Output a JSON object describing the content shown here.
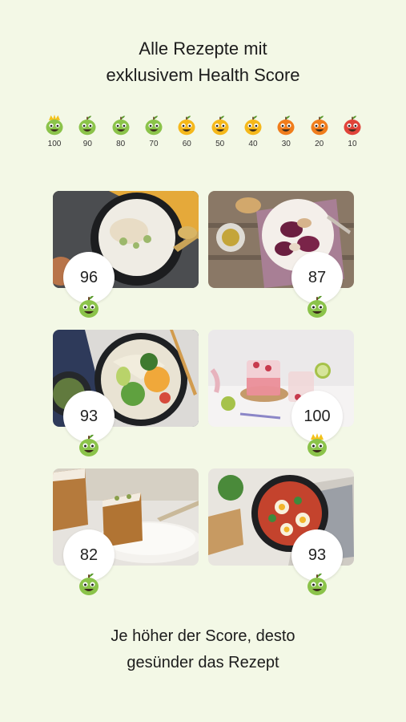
{
  "header": {
    "line1": "Alle Rezepte mit",
    "line2": "exklusivem Health Score"
  },
  "scale": [
    {
      "label": "100",
      "icon": "crown-green-mascot-icon",
      "color": "#8bc34a"
    },
    {
      "label": "90",
      "icon": "green-mascot-icon",
      "color": "#8bc34a"
    },
    {
      "label": "80",
      "icon": "green-mascot-icon",
      "color": "#8bc34a"
    },
    {
      "label": "70",
      "icon": "green-mascot-icon",
      "color": "#8bc34a"
    },
    {
      "label": "60",
      "icon": "yellow-mascot-icon",
      "color": "#f5b81b"
    },
    {
      "label": "50",
      "icon": "yellow-mascot-icon",
      "color": "#f5b81b"
    },
    {
      "label": "40",
      "icon": "yellow-mascot-icon",
      "color": "#f5b81b"
    },
    {
      "label": "30",
      "icon": "orange-mascot-icon",
      "color": "#f07d1c"
    },
    {
      "label": "20",
      "icon": "orange-mascot-icon",
      "color": "#f07d1c"
    },
    {
      "label": "10",
      "icon": "red-mascot-icon",
      "color": "#e0443a"
    }
  ],
  "recipes": [
    {
      "score": "96",
      "image": "rice-pear-bowl-photo",
      "crown": false
    },
    {
      "score": "87",
      "image": "beetroot-carpaccio-photo",
      "crown": false
    },
    {
      "score": "93",
      "image": "asian-noodle-bowl-photo",
      "crown": false
    },
    {
      "score": "100",
      "image": "raspberry-lime-drink-photo",
      "crown": true
    },
    {
      "score": "82",
      "image": "carrot-cake-photo",
      "crown": false
    },
    {
      "score": "93",
      "image": "shakshuka-pan-photo",
      "crown": false
    }
  ],
  "footer": {
    "line1": "Je höher der Score, desto",
    "line2": "gesünder das Rezept"
  },
  "colors": {
    "background": "#f3f8e6",
    "mascot_green": "#8bc34a"
  }
}
